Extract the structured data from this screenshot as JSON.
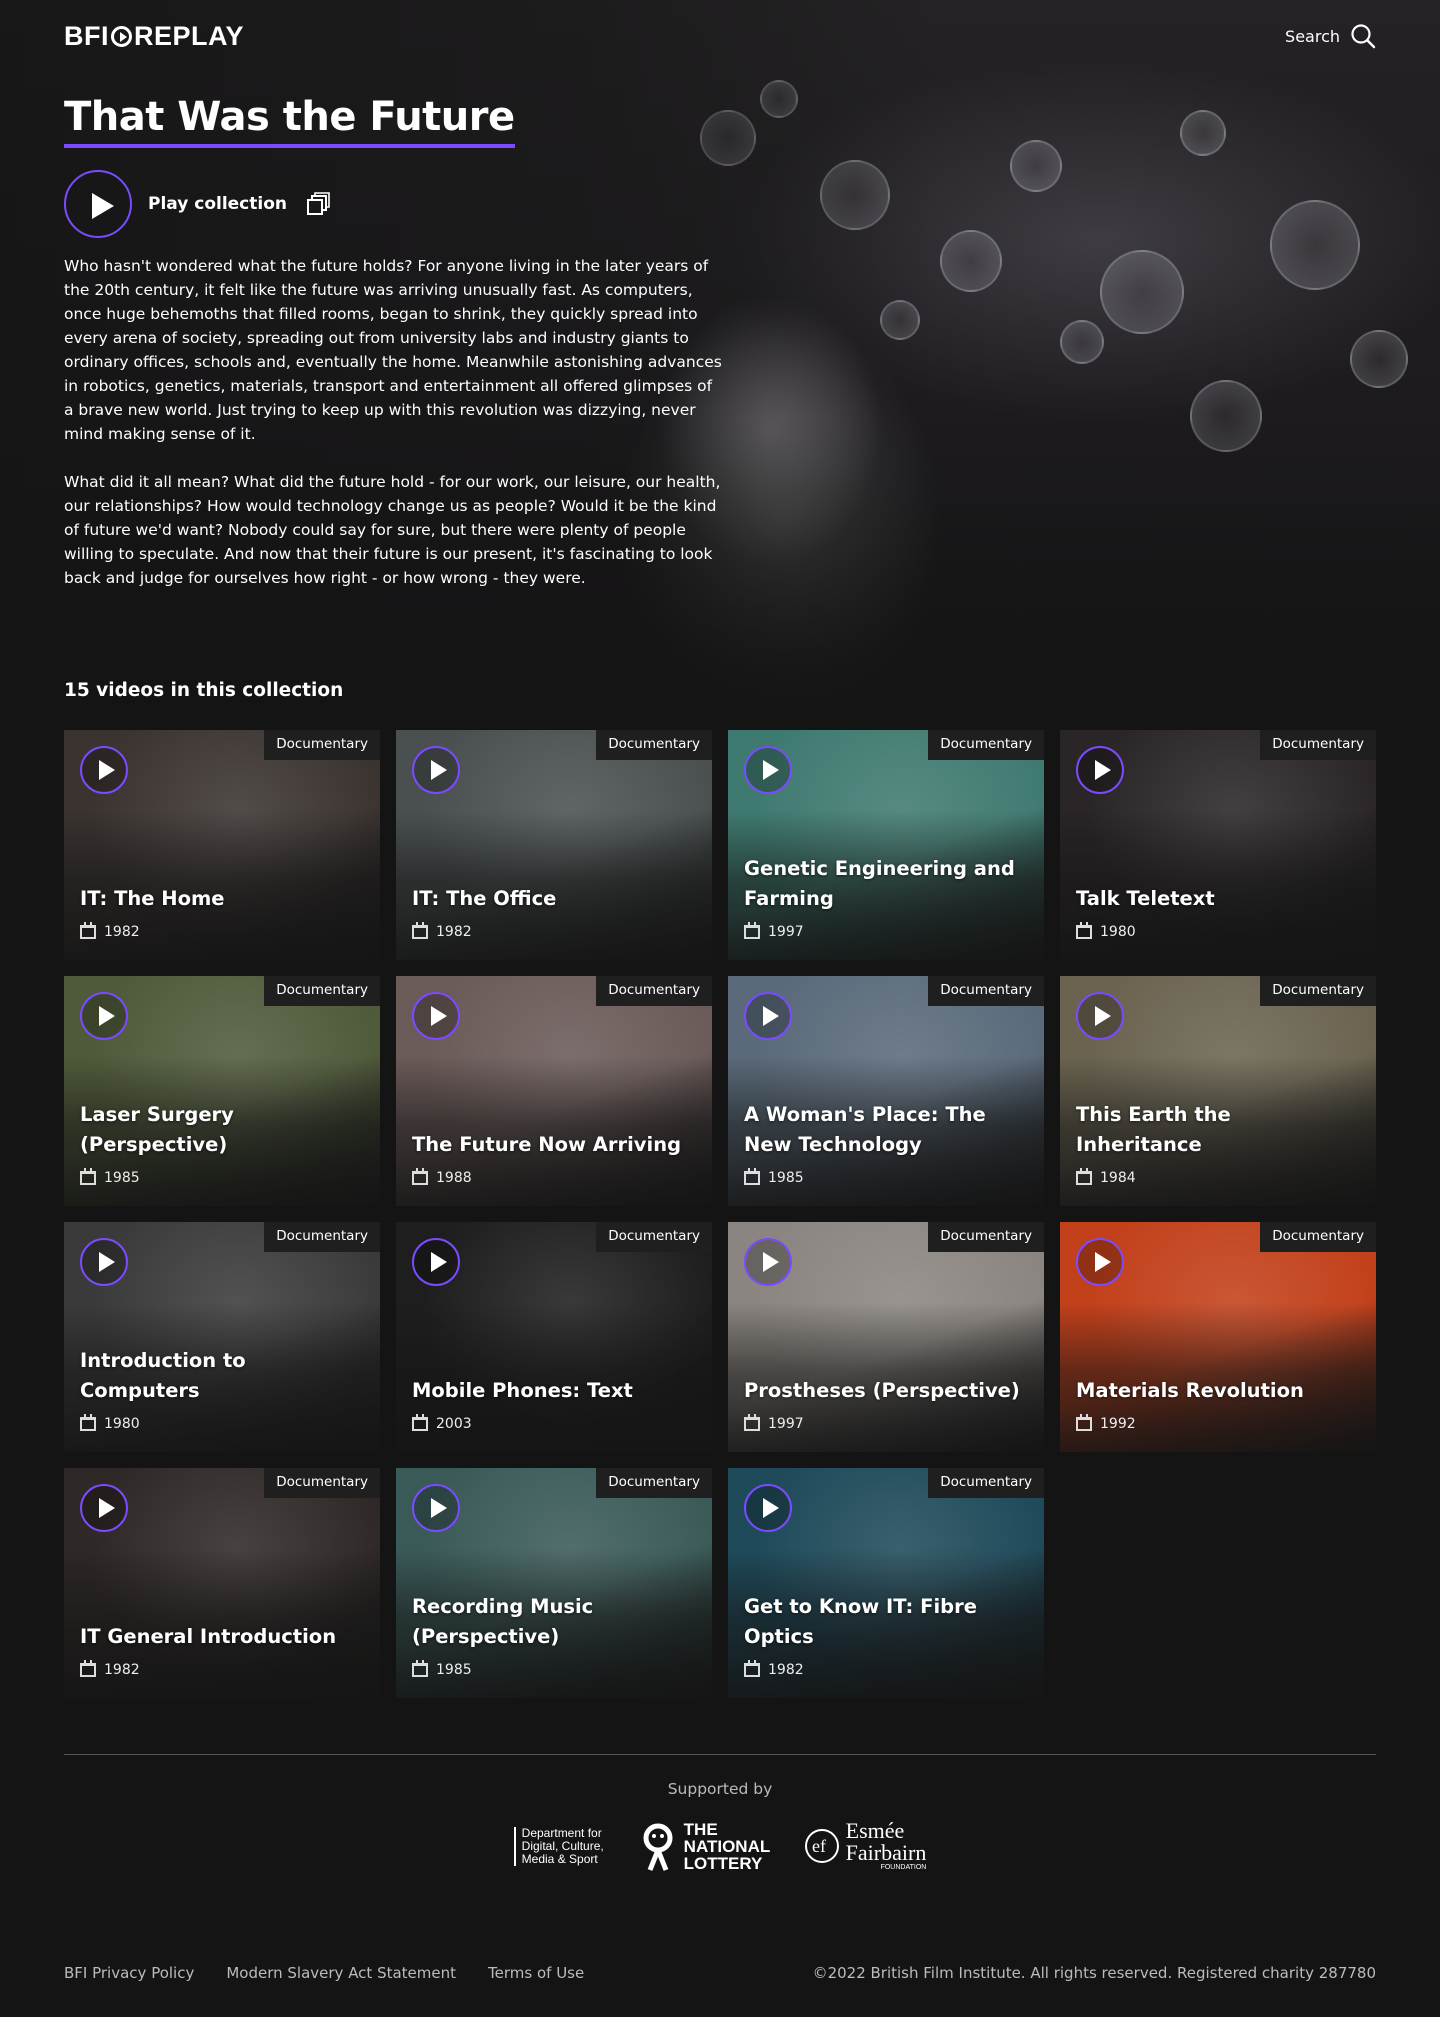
{
  "header": {
    "logo_text_left": "BFI",
    "logo_text_right": "REPLAY",
    "search_label": "Search"
  },
  "collection": {
    "title": "That Was the Future",
    "play_label": "Play collection",
    "description": [
      "Who hasn't wondered what the future holds? For anyone living in the later years of the 20th century, it felt like the future was arriving unusually fast. As computers, once huge behemoths that filled rooms, began to shrink, they quickly spread into every arena of society, spreading out from university labs and industry giants to ordinary offices, schools and, eventually the home. Meanwhile astonishing advances in robotics, genetics, materials, transport and entertainment all offered glimpses of a brave new world. Just trying to keep up with this revolution was dizzying, never mind making sense of it.",
      "What did it all mean? What did the future hold - for our work, our leisure, our health, our relationships? How would technology change us as people? Would it be the kind of future we'd want? Nobody could say for sure, but there were plenty of people willing to speculate. And now that their future is our present, it's fascinating to look back and judge for ourselves how right - or how wrong - they were."
    ],
    "count_label": "15 videos in this collection"
  },
  "videos": [
    {
      "title": "IT: The Home",
      "year": "1982",
      "genre": "Documentary",
      "color": "#3a3330"
    },
    {
      "title": "IT: The Office",
      "year": "1982",
      "genre": "Documentary",
      "color": "#4a5050"
    },
    {
      "title": "Genetic Engineering and Farming",
      "year": "1997",
      "genre": "Documentary",
      "color": "#3f7a70"
    },
    {
      "title": "Talk Teletext",
      "year": "1980",
      "genre": "Documentary",
      "color": "#2a2526"
    },
    {
      "title": "Laser Surgery (Perspective)",
      "year": "1985",
      "genre": "Documentary",
      "color": "#4f5a3a"
    },
    {
      "title": "The Future Now Arriving",
      "year": "1988",
      "genre": "Documentary",
      "color": "#6a5a58"
    },
    {
      "title": "A Woman's Place: The New Technology",
      "year": "1985",
      "genre": "Documentary",
      "color": "#5a6a7a"
    },
    {
      "title": "This Earth the Inheritance",
      "year": "1984",
      "genre": "Documentary",
      "color": "#6a6350"
    },
    {
      "title": "Introduction to Computers",
      "year": "1980",
      "genre": "Documentary",
      "color": "#3a3a3a"
    },
    {
      "title": "Mobile Phones: Text",
      "year": "2003",
      "genre": "Documentary",
      "color": "#1e1e1e"
    },
    {
      "title": "Prostheses (Perspective)",
      "year": "1997",
      "genre": "Documentary",
      "color": "#8a8580"
    },
    {
      "title": "Materials Revolution",
      "year": "1992",
      "genre": "Documentary",
      "color": "#c2401a"
    },
    {
      "title": "IT General Introduction",
      "year": "1982",
      "genre": "Documentary",
      "color": "#2e2826"
    },
    {
      "title": "Recording Music (Perspective)",
      "year": "1985",
      "genre": "Documentary",
      "color": "#3a5a58"
    },
    {
      "title": "Get to Know IT: Fibre Optics",
      "year": "1982",
      "genre": "Documentary",
      "color": "#1f4a5a"
    }
  ],
  "footer": {
    "supported_by": "Supported by",
    "sponsors": {
      "dcms": "Department for Digital, Culture, Media & Sport",
      "lottery": "THE NATIONAL LOTTERY",
      "esmee_line1": "Esmée",
      "esmee_line2": "Fairbairn",
      "esmee_line3": "FOUNDATION"
    },
    "links": [
      "BFI Privacy Policy",
      "Modern Slavery Act Statement",
      "Terms of Use"
    ],
    "copyright": "©2022 British Film Institute. All rights reserved. Registered charity 287780"
  },
  "theme": {
    "accent": "#7a4bff",
    "background": "#141414"
  }
}
